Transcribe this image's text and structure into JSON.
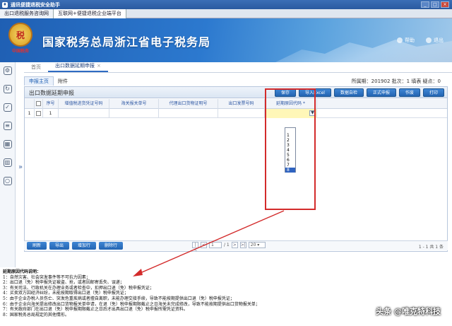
{
  "window": {
    "title": "通讯便捷退税安全助手",
    "buttons": [
      "_",
      "□",
      "×"
    ]
  },
  "browser_tabs": [
    {
      "label": "出口退税服务咨询网"
    },
    {
      "label": "互联网+便捷退税企业端平台"
    }
  ],
  "header": {
    "emblem_text": "税",
    "emblem_sub": "中国税务",
    "bureau_name": "国家税务总局浙江省电子税务局",
    "links": [
      {
        "label": "帮助"
      },
      {
        "label": "退出"
      }
    ]
  },
  "page_tabs": {
    "home": "首页",
    "current": "出口数据延期申报",
    "close": "×"
  },
  "sub_tabs": {
    "main": "申报主页",
    "attach": "附件"
  },
  "meta_info": "所属期：201902  批次：1  填表  疑点：0",
  "panel": {
    "title": "出口数据延期申报",
    "toolbar": [
      {
        "label": "保存"
      },
      {
        "label": "导入Excel"
      },
      {
        "label": "数据自检"
      },
      {
        "label": "正式申报"
      },
      {
        "label": "作废"
      },
      {
        "label": "打印"
      }
    ]
  },
  "grid": {
    "columns": [
      "",
      "序号",
      "增值税进货凭证号码",
      "海关报关单号",
      "代理出口货物证明号",
      "出口发票号码",
      "延期原因代码 *"
    ],
    "rows": [
      {
        "idx": "1",
        "seq": "1",
        "vat": "",
        "customs": "",
        "agent": "",
        "invoice": "",
        "reason": ""
      }
    ]
  },
  "dropdown": {
    "arrow": "▼",
    "options": [
      "",
      "1",
      "2",
      "3",
      "4",
      "5",
      "6",
      "7",
      "8"
    ],
    "selected_index": 8
  },
  "bottom": {
    "buttons": [
      {
        "label": "刷新"
      },
      {
        "label": "导出"
      },
      {
        "label": "增加行"
      },
      {
        "label": "删除行"
      }
    ],
    "pager": {
      "first": "|<",
      "prev": "<",
      "page_value": "1",
      "total_pages": "/ 1",
      "next": ">",
      "last": ">|",
      "page_size": "20 ▾",
      "info": "1 - 1  共 1 条"
    }
  },
  "notes": {
    "title": "延期原因代码说明：",
    "lines": [
      "1：自然灾害、社会突发事件等不可抗力因素；",
      "2：出口退（免）税申报凭证被盗、抢，或者因邮寄丢失、误递；",
      "3：有关司法、行政机关在办理业务或者检查中，扣押出口退（免）税申报凭证；",
      "4：买卖双方因经济纠纷，未能按期取得出口退（免）税申报凭证；",
      "5：由于企业办税人员伤亡、突发危重疾病或者擅自离职，未能办理交接手续，导致不能按期提供出口退（免）税申报凭证；",
      "6：由于企业向海关提出修改出口货物报关单申请，在退（免）税申报期限截止之日海关未完成修改，导致不能按期提供出口货物报关单；",
      "7：有关政府部门在出口退（免）税申报期限截止之日后才出具出口退（免）税申报所需凭证资料。",
      "8：国家税务总局规定的其他情形。"
    ]
  },
  "watermark": "头条 @唯克特科技",
  "colors": {
    "accent": "#2364b2",
    "highlight_box": "#d32b2b",
    "selected_cell": "#fff7b8"
  }
}
